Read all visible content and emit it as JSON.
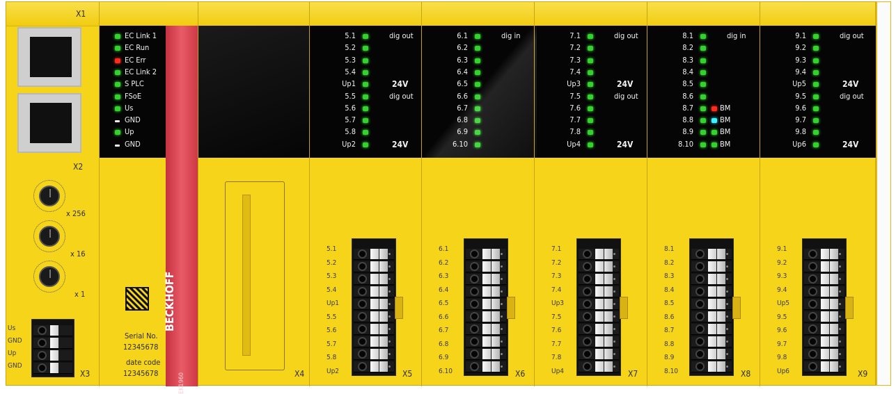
{
  "module_headers": [
    "X1"
  ],
  "module_labels": {
    "x2": "X2",
    "x3": "X3",
    "x4": "X4",
    "x5": "X5",
    "x6": "X6",
    "x7": "X7",
    "x8": "X8",
    "x9": "X9"
  },
  "coupler": {
    "status_leds": [
      {
        "label": "EC Link 1",
        "color": "green"
      },
      {
        "label": "EC Run",
        "color": "green"
      },
      {
        "label": "EC Err",
        "color": "red"
      },
      {
        "label": "EC Link 2",
        "color": "green"
      },
      {
        "label": "S PLC",
        "color": "green"
      },
      {
        "label": "FSoE",
        "color": "green"
      },
      {
        "label": "Us",
        "color": "green"
      },
      {
        "label": "GND",
        "color": "white"
      },
      {
        "label": "Up",
        "color": "green"
      },
      {
        "label": "GND",
        "color": "white"
      }
    ],
    "dial_labels": [
      "x 256",
      "x 16",
      "x 1"
    ],
    "power_terminals": [
      "Us",
      "GND",
      "Up",
      "GND"
    ],
    "serial_label": "Serial No.",
    "serial_value": "12345678",
    "date_label": "date code",
    "date_value": "12345678",
    "brand": "BECKHOFF",
    "model": "EK1960"
  },
  "io_modules": [
    {
      "id": "X5",
      "channels": [
        "5.1",
        "5.2",
        "5.3",
        "5.4",
        "Up1",
        "5.5",
        "5.6",
        "5.7",
        "5.8",
        "Up2"
      ],
      "side_texts": [
        {
          "row": 0,
          "text": "dig out"
        },
        {
          "row": 4,
          "text": "24V"
        },
        {
          "row": 5,
          "text": "dig out"
        },
        {
          "row": 9,
          "text": "24V"
        }
      ],
      "terminal_labels": [
        "5.1",
        "5.2",
        "5.3",
        "5.4",
        "Up1",
        "5.5",
        "5.6",
        "5.7",
        "5.8",
        "Up2"
      ]
    },
    {
      "id": "X6",
      "channels": [
        "6.1",
        "6.2",
        "6.3",
        "6.4",
        "6.5",
        "6.6",
        "6.7",
        "6.8",
        "6.9",
        "6.10"
      ],
      "side_texts": [
        {
          "row": 0,
          "text": "dig in"
        }
      ],
      "terminal_labels": [
        "6.1",
        "6.2",
        "6.3",
        "6.4",
        "6.5",
        "6.6",
        "6.7",
        "6.8",
        "6.9",
        "6.10"
      ]
    },
    {
      "id": "X7",
      "channels": [
        "7.1",
        "7.2",
        "7.3",
        "7.4",
        "Up3",
        "7.5",
        "7.6",
        "7.7",
        "7.8",
        "Up4"
      ],
      "side_texts": [
        {
          "row": 0,
          "text": "dig out"
        },
        {
          "row": 4,
          "text": "24V"
        },
        {
          "row": 5,
          "text": "dig out"
        },
        {
          "row": 9,
          "text": "24V"
        }
      ],
      "terminal_labels": [
        "7.1",
        "7.2",
        "7.3",
        "7.4",
        "Up3",
        "7.5",
        "7.6",
        "7.7",
        "7.8",
        "Up4"
      ]
    },
    {
      "id": "X8",
      "channels": [
        "8.1",
        "8.2",
        "8.3",
        "8.4",
        "8.5",
        "8.6",
        "8.7",
        "8.8",
        "8.9",
        "8.10"
      ],
      "side_texts": [
        {
          "row": 0,
          "text": "dig in"
        },
        {
          "row": 6,
          "text": "BM"
        },
        {
          "row": 7,
          "text": "BM"
        },
        {
          "row": 8,
          "text": "BM"
        },
        {
          "row": 9,
          "text": "BM"
        }
      ],
      "bm_colors": {
        "6": "red",
        "7": "cyan",
        "8": "green",
        "9": "green"
      },
      "terminal_labels": [
        "8.1",
        "8.2",
        "8.3",
        "8.4",
        "8.5",
        "8.6",
        "8.7",
        "8.8",
        "8.9",
        "8.10"
      ]
    },
    {
      "id": "X9",
      "channels": [
        "9.1",
        "9.2",
        "9.3",
        "9.4",
        "Up5",
        "9.5",
        "9.6",
        "9.7",
        "9.8",
        "Up6"
      ],
      "side_texts": [
        {
          "row": 0,
          "text": "dig out"
        },
        {
          "row": 4,
          "text": "24V"
        },
        {
          "row": 5,
          "text": "dig out"
        },
        {
          "row": 9,
          "text": "24V"
        }
      ],
      "terminal_labels": [
        "9.1",
        "9.2",
        "9.3",
        "9.4",
        "Up5",
        "9.5",
        "9.6",
        "9.7",
        "9.8",
        "Up6"
      ]
    }
  ],
  "colors": {
    "housing": "#f6d41a",
    "panel": "#050505",
    "led_green": "#35d12e",
    "led_red": "#ff2a1a",
    "led_cyan": "#3ef2ff",
    "brand_bar": "#d8414e"
  }
}
